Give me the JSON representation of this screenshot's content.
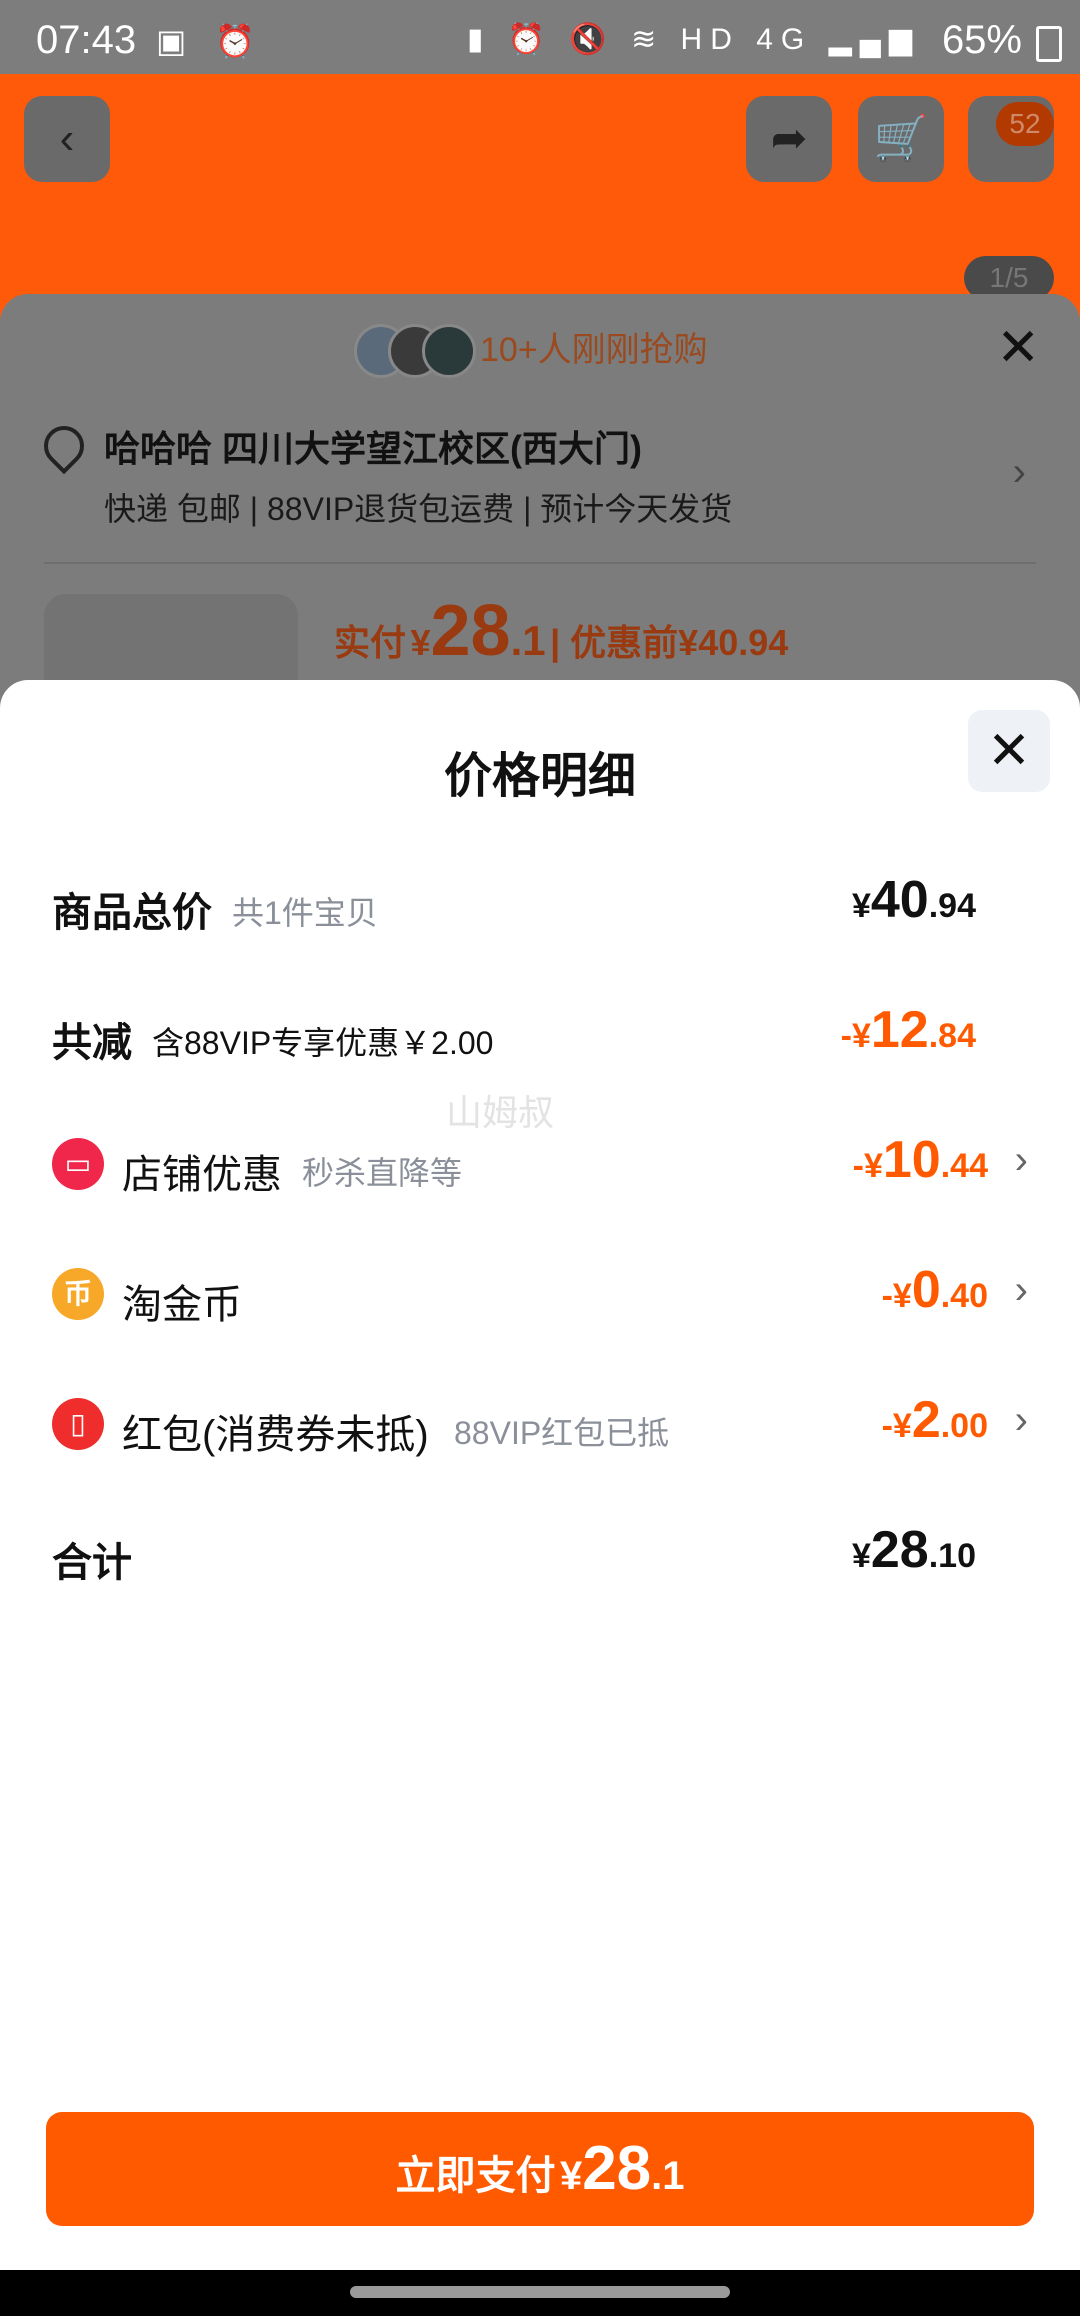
{
  "status_bar": {
    "time": "07:43",
    "battery": "65%",
    "network": "4G",
    "hd": "HD"
  },
  "background_page": {
    "cart_badge": "52",
    "image_counter": "1/5",
    "buyers_text": "10+人刚刚抢购",
    "address_name": "哈哈哈 四川大学望江校区(西大门)",
    "shipping": [
      "快递 包邮",
      "88VIP退货包运费",
      "预计今天发货"
    ],
    "pay_label": "实付",
    "pay_currency": "¥",
    "pay_int": "28",
    "pay_dec": ".1",
    "before_label": "优惠前",
    "before_price": "¥40.94"
  },
  "sheet": {
    "title": "价格明细",
    "watermark": "山姆叔",
    "rows": [
      {
        "label": "商品总价",
        "sub": "共1件宝贝",
        "cur": "¥",
        "int": "40",
        "dec": ".94"
      },
      {
        "label": "共减",
        "sub": "含88VIP专享优惠￥2.00",
        "cur": "-¥",
        "int": "12",
        "dec": ".84"
      },
      {
        "label": "店铺优惠",
        "sub": "秒杀直降等",
        "cur": "-¥",
        "int": "10",
        "dec": ".44",
        "icon": "store-coupon-icon"
      },
      {
        "label": "淘金币",
        "sub": "",
        "cur": "-¥",
        "int": "0",
        "dec": ".40",
        "icon": "gold-coin-icon"
      },
      {
        "label": "红包(消费券未抵)",
        "sub": "88VIP红包已抵",
        "cur": "-¥",
        "int": "2",
        "dec": ".00",
        "icon": "red-packet-icon"
      },
      {
        "label": "合计",
        "sub": "",
        "cur": "¥",
        "int": "28",
        "dec": ".10"
      }
    ],
    "pay_button": {
      "label": "立即支付",
      "cur": "¥",
      "int": "28",
      "dec": ".1"
    }
  },
  "colors": {
    "accent": "#ff5a00",
    "text": "#111111",
    "muted": "#8a8f99"
  }
}
